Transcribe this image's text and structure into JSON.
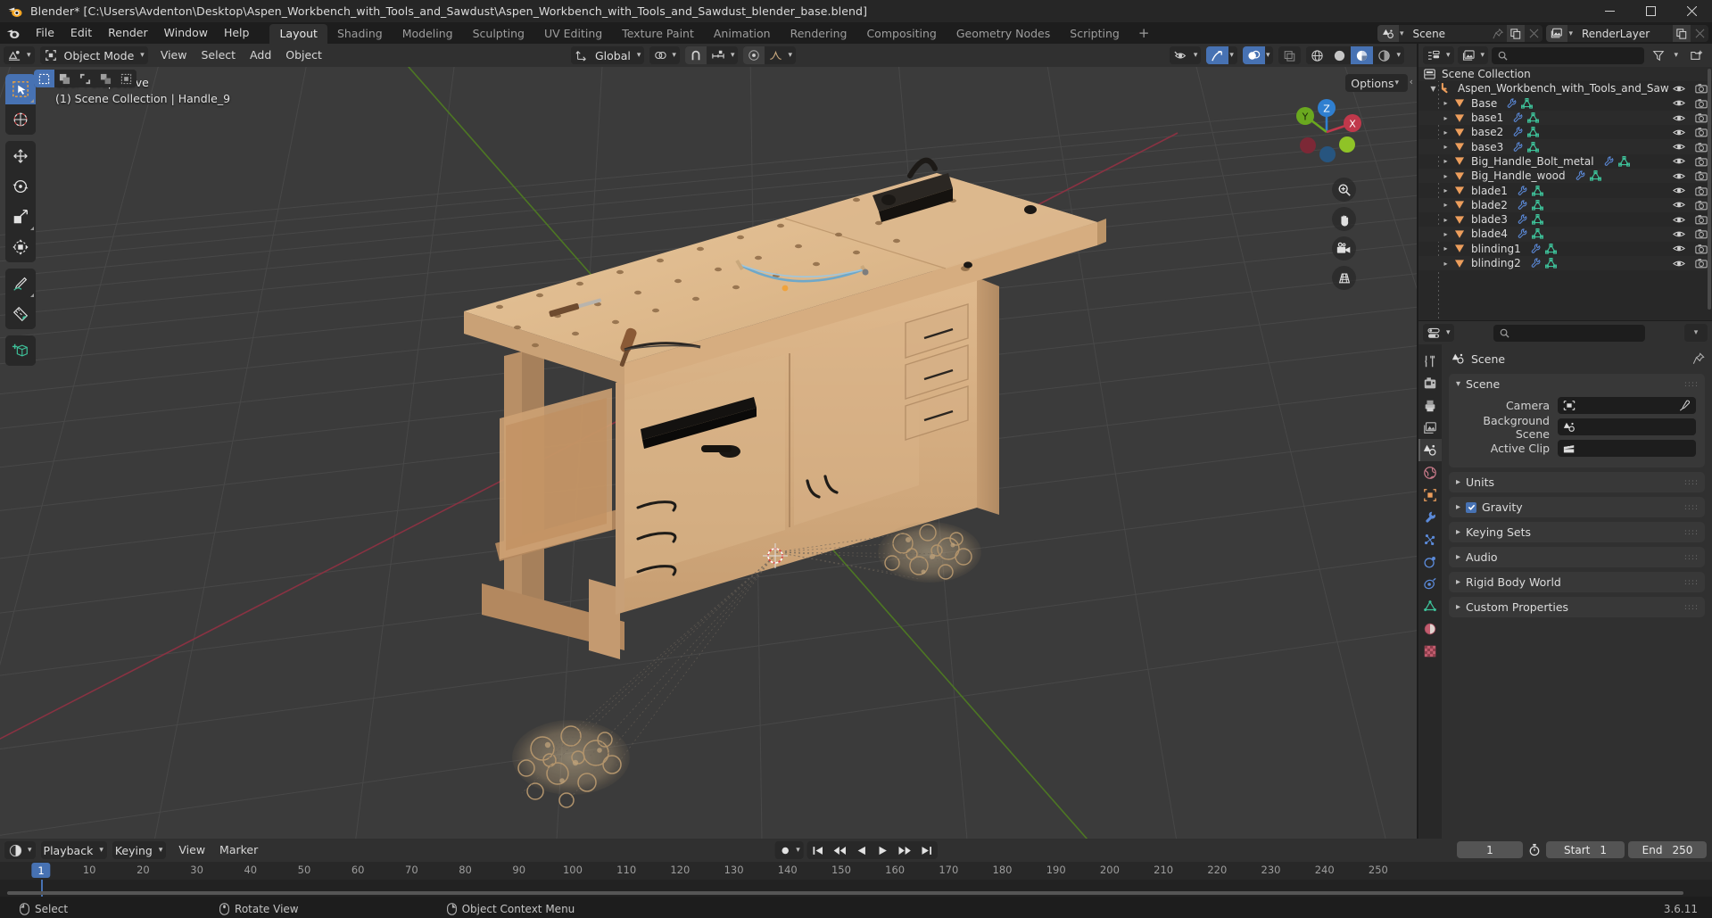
{
  "window": {
    "title": "Blender* [C:\\Users\\Avdenton\\Desktop\\Aspen_Workbench_with_Tools_and_Sawdust\\Aspen_Workbench_with_Tools_and_Sawdust_blender_base.blend]",
    "minimize": "–",
    "maximize": "❐",
    "close": "✕"
  },
  "topbar": {
    "menus": [
      "File",
      "Edit",
      "Render",
      "Window",
      "Help"
    ],
    "workspaces": [
      {
        "label": "Layout",
        "active": true
      },
      {
        "label": "Shading",
        "active": false
      },
      {
        "label": "Modeling",
        "active": false
      },
      {
        "label": "Sculpting",
        "active": false
      },
      {
        "label": "UV Editing",
        "active": false
      },
      {
        "label": "Texture Paint",
        "active": false
      },
      {
        "label": "Animation",
        "active": false
      },
      {
        "label": "Rendering",
        "active": false
      },
      {
        "label": "Compositing",
        "active": false
      },
      {
        "label": "Geometry Nodes",
        "active": false
      },
      {
        "label": "Scripting",
        "active": false
      }
    ],
    "add_workspace": "+",
    "scene_name": "Scene",
    "viewlayer_name": "RenderLayer"
  },
  "viewport": {
    "mode": "Object Mode",
    "menus": [
      "View",
      "Select",
      "Add",
      "Object"
    ],
    "transform_orientation": "Global",
    "options_label": "Options",
    "overlay_line1": "User Perspective",
    "overlay_line2": "(1) Scene Collection | Handle_9",
    "gizmo_axes": [
      "X",
      "Y",
      "Z"
    ],
    "collapse_arrow": "‹"
  },
  "outliner": {
    "search_placeholder": "",
    "root": "Scene Collection",
    "collection": "Aspen_Workbench_with_Tools_and_Saw",
    "items": [
      {
        "label": "Base",
        "modifier": true,
        "mesh": true
      },
      {
        "label": "base1",
        "modifier": true,
        "mesh": true
      },
      {
        "label": "base2",
        "modifier": true,
        "mesh": true
      },
      {
        "label": "base3",
        "modifier": true,
        "mesh": true
      },
      {
        "label": "Big_Handle_Bolt_metal",
        "modifier": true,
        "mesh": true
      },
      {
        "label": "Big_Handle_wood",
        "modifier": true,
        "mesh": true
      },
      {
        "label": "blade1",
        "modifier": true,
        "mesh": true
      },
      {
        "label": "blade2",
        "modifier": true,
        "mesh": true
      },
      {
        "label": "blade3",
        "modifier": true,
        "mesh": true
      },
      {
        "label": "blade4",
        "modifier": true,
        "mesh": true
      },
      {
        "label": "blinding1",
        "modifier": true,
        "mesh": true
      },
      {
        "label": "blinding2",
        "modifier": true,
        "mesh": true
      }
    ]
  },
  "properties": {
    "breadcrumb": "Scene",
    "panels": [
      {
        "title": "Scene",
        "open": true,
        "checkbox": false
      },
      {
        "title": "Units",
        "open": false,
        "checkbox": false
      },
      {
        "title": "Gravity",
        "open": false,
        "checkbox": true
      },
      {
        "title": "Keying Sets",
        "open": false,
        "checkbox": false
      },
      {
        "title": "Audio",
        "open": false,
        "checkbox": false
      },
      {
        "title": "Rigid Body World",
        "open": false,
        "checkbox": false
      },
      {
        "title": "Custom Properties",
        "open": false,
        "checkbox": false
      }
    ],
    "scene_fields": [
      {
        "label": "Camera",
        "value": "",
        "icon": "camera-data-icon",
        "eyedropper": true
      },
      {
        "label": "Background Scene",
        "value": "",
        "icon": "scene-icon",
        "eyedropper": false
      },
      {
        "label": "Active Clip",
        "value": "",
        "icon": "clip-icon",
        "eyedropper": false
      }
    ]
  },
  "timeline": {
    "menus": [
      "Playback",
      "Keying",
      "View",
      "Marker"
    ],
    "current_frame": "1",
    "start_label": "Start",
    "start_value": "1",
    "end_label": "End",
    "end_value": "250",
    "ticks": [
      "10",
      "20",
      "30",
      "40",
      "50",
      "60",
      "70",
      "80",
      "90",
      "100",
      "110",
      "120",
      "130",
      "140",
      "150",
      "160",
      "170",
      "180",
      "190",
      "200",
      "210",
      "220",
      "230",
      "240",
      "250"
    ],
    "playhead_label": "1"
  },
  "statusbar": {
    "hints": [
      {
        "icon": "mouse-left-icon",
        "label": "Select"
      },
      {
        "icon": "mouse-middle-icon",
        "label": "Rotate View"
      },
      {
        "icon": "mouse-right-icon",
        "label": "Object Context Menu"
      }
    ],
    "version": "3.6.11"
  },
  "colors": {
    "accent_blue": "#4772b3",
    "panel_bg": "#303030",
    "viewport_bg": "#3b3b3b",
    "outliner_row": "#282828",
    "axis_x": "#c0384b",
    "axis_y": "#6aa81f",
    "axis_z": "#2f7fd0",
    "mesh_green": "#3ec29a",
    "modifier_blue": "#5b8ad9",
    "object_orange": "#ed9e5c"
  }
}
